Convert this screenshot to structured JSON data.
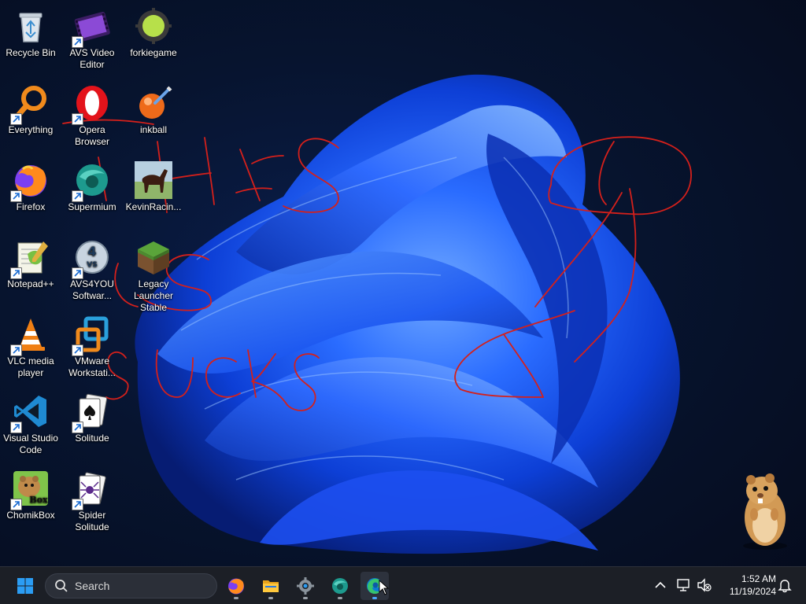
{
  "desktop": {
    "icons": [
      {
        "label": "Recycle Bin",
        "icon": "recycle-bin-icon"
      },
      {
        "label": "AVS Video Editor",
        "icon": "avs-video-editor-icon"
      },
      {
        "label": "forkiegame",
        "icon": "forkiegame-icon"
      },
      {
        "label": "Everything",
        "icon": "everything-search-icon"
      },
      {
        "label": "Opera Browser",
        "icon": "opera-icon"
      },
      {
        "label": "inkball",
        "icon": "inkball-icon"
      },
      {
        "label": "Firefox",
        "icon": "firefox-icon"
      },
      {
        "label": "Supermium",
        "icon": "supermium-icon"
      },
      {
        "label": "KevinRacin...",
        "icon": "horse-icon"
      },
      {
        "label": "Notepad++",
        "icon": "notepad-plus-plus-icon"
      },
      {
        "label": "AVS4YOU Softwar...",
        "icon": "avs4you-icon"
      },
      {
        "label": "Legacy Launcher Stable",
        "icon": "minecraft-grass-block-icon"
      },
      {
        "label": "VLC media player",
        "icon": "vlc-icon"
      },
      {
        "label": "VMware Workstati...",
        "icon": "vmware-icon"
      },
      {
        "label": "Visual Studio Code",
        "icon": "vscode-icon"
      },
      {
        "label": "Solitude",
        "icon": "solitaire-cards-icon"
      },
      {
        "label": "ChomikBox",
        "icon": "chomikbox-hamster-icon"
      },
      {
        "label": "Spider Solitude",
        "icon": "spider-solitaire-icon"
      }
    ]
  },
  "taskbar": {
    "search_placeholder": "Search",
    "time": "1:52 AM",
    "date": "11/19/2024",
    "pinned": [
      "start-icon",
      "firefox-icon",
      "file-explorer-icon",
      "settings-gear-icon",
      "supermium-icon",
      "edge-icon"
    ]
  },
  "colors": {
    "taskbar": "#1c1f26",
    "accent": "#0078d4",
    "scribble": "#d4201b"
  }
}
